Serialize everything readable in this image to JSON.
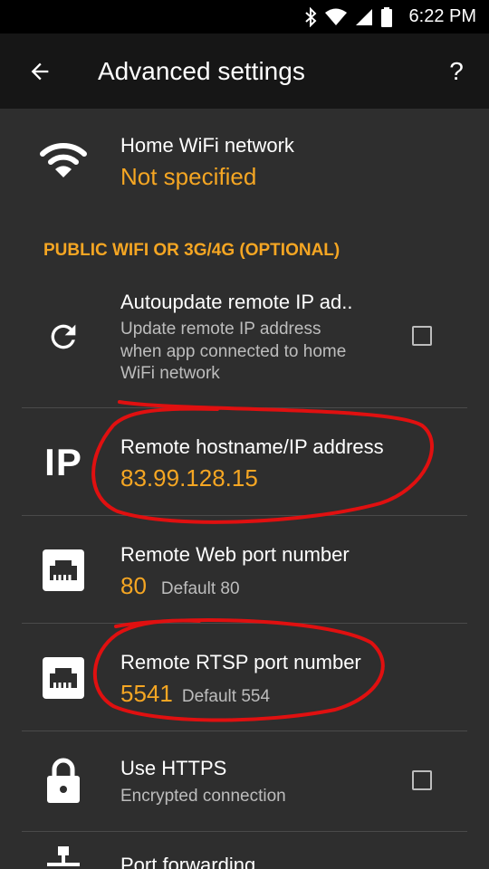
{
  "status_bar": {
    "time": "6:22 PM",
    "icons": [
      "bluetooth-icon",
      "wifi-icon",
      "signal-icon",
      "battery-icon"
    ]
  },
  "app_bar": {
    "title": "Advanced settings",
    "help_label": "?",
    "icons": [
      "back-arrow-icon"
    ]
  },
  "home_wifi": {
    "title": "Home WiFi network",
    "value": "Not specified",
    "icon": "wifi-icon"
  },
  "section_public": {
    "header": "PUBLIC WIFI OR 3G/4G (OPTIONAL)"
  },
  "autoupdate": {
    "title": "Autoupdate remote IP ad..",
    "summary_lines": [
      "Update remote IP address",
      "when app connected to home",
      "WiFi network"
    ],
    "checked": false,
    "icon": "refresh-icon"
  },
  "remote_host": {
    "icon_label": "IP",
    "title": "Remote hostname/IP address",
    "value": "83.99.128.15"
  },
  "web_port": {
    "title": "Remote Web port number",
    "value": "80",
    "default": "Default 80",
    "icon": "ethernet-port-icon"
  },
  "rtsp_port": {
    "title": "Remote RTSP port number",
    "value": "5541",
    "default": "Default 554",
    "icon": "ethernet-port-icon"
  },
  "https": {
    "title": "Use HTTPS",
    "summary": "Encrypted connection",
    "checked": false,
    "icon": "lock-icon"
  },
  "port_forwarding": {
    "title": "Port forwarding",
    "icon": "network-icon"
  },
  "colors": {
    "accent": "#f5a623",
    "background": "#2e2e2e",
    "app_bar": "#161616",
    "annotation": "#e01010"
  }
}
